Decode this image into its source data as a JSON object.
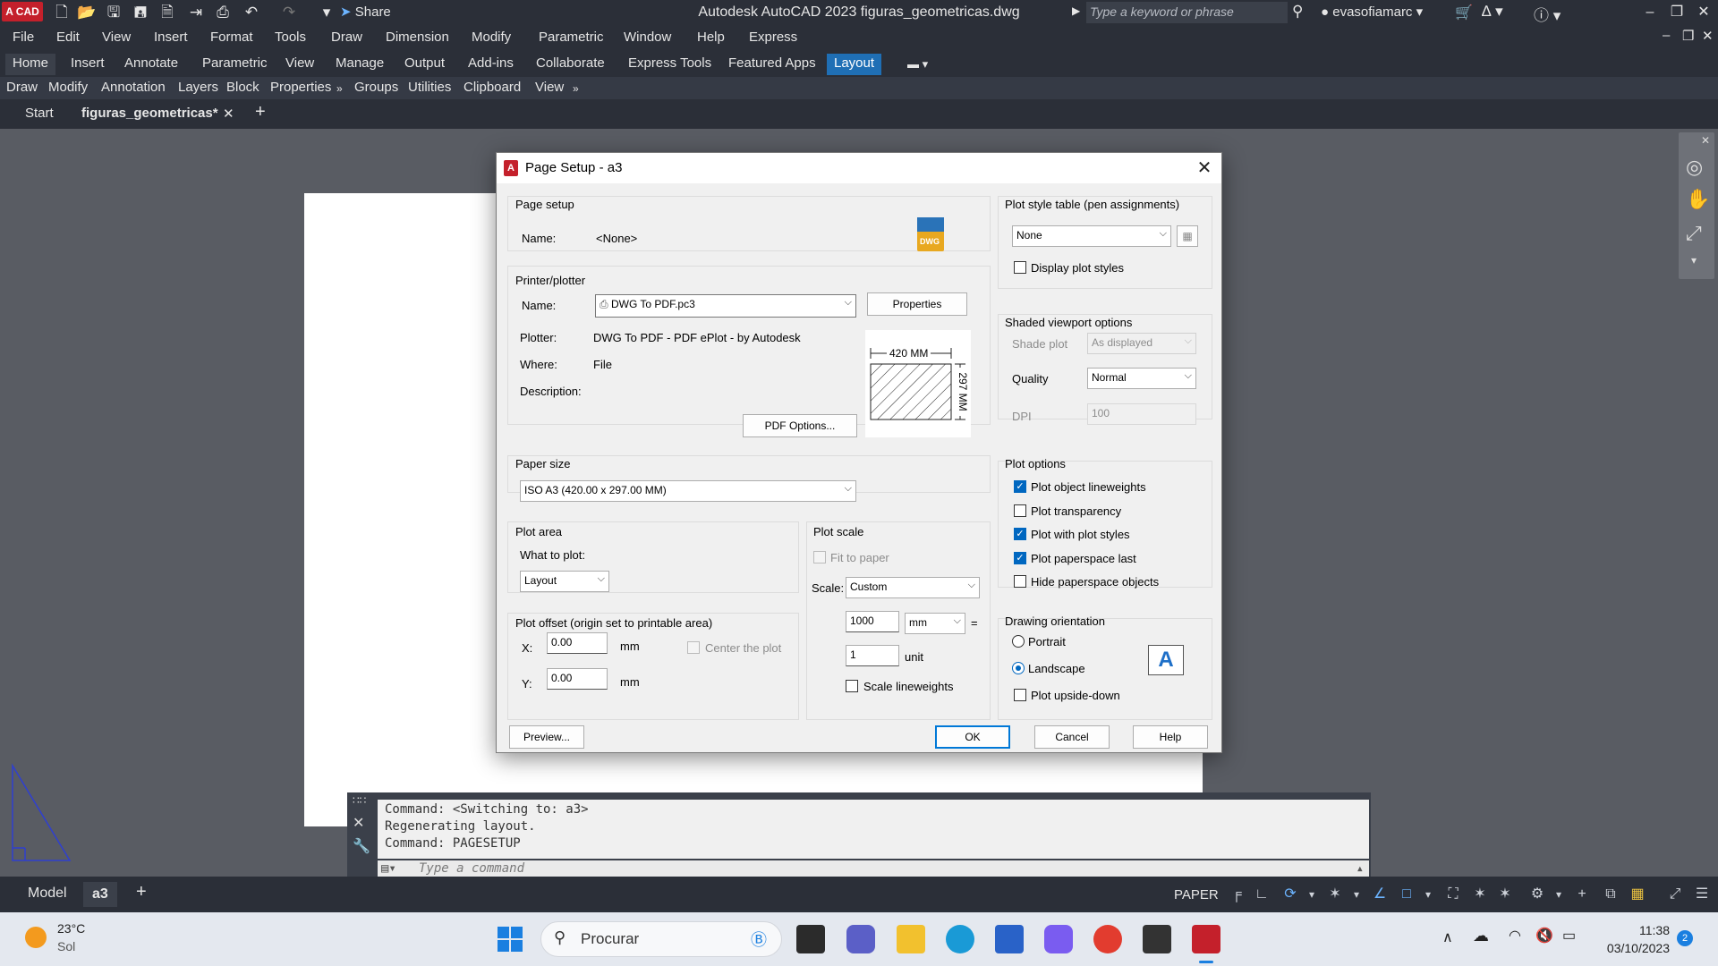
{
  "titlebar": {
    "app_logo": "A CAD",
    "share": "Share",
    "title": "Autodesk AutoCAD 2023    figuras_geometricas.dwg",
    "keyword_placeholder": "Type a keyword or phrase",
    "user": "evasofiamarc"
  },
  "menubar": [
    "File",
    "Edit",
    "View",
    "Insert",
    "Format",
    "Tools",
    "Draw",
    "Dimension",
    "Modify",
    "Parametric",
    "Window",
    "Help",
    "Express"
  ],
  "ribbon_tabs": [
    "Home",
    "Insert",
    "Annotate",
    "Parametric",
    "View",
    "Manage",
    "Output",
    "Add-ins",
    "Collaborate",
    "Express Tools",
    "Featured Apps",
    "Layout"
  ],
  "panels": [
    "Draw",
    "Modify",
    "Annotation",
    "Layers",
    "Block",
    "Properties",
    "Groups",
    "Utilities",
    "Clipboard",
    "View"
  ],
  "file_tabs": {
    "start": "Start",
    "file": "figuras_geometricas*"
  },
  "command": {
    "lines": [
      "Command:   <Switching to: a3>",
      "Regenerating layout.",
      "Command: PAGESETUP"
    ],
    "placeholder": "Type a command"
  },
  "layout_tabs": {
    "model": "Model",
    "a3": "a3",
    "paper": "PAPER"
  },
  "taskbar": {
    "temp": "23°C",
    "weather": "Sol",
    "search": "Procurar",
    "time": "11:38",
    "date": "03/10/2023",
    "notif": "2"
  },
  "dialog": {
    "title": "Page Setup - a3",
    "page_setup": {
      "title": "Page setup",
      "name_label": "Name:",
      "name_value": "<None>",
      "dwg_icon": "DWG"
    },
    "printer": {
      "title": "Printer/plotter",
      "name_label": "Name:",
      "name_value": "DWG To PDF.pc3",
      "properties": "Properties",
      "plotter_label": "Plotter:",
      "plotter_value": "DWG To PDF - PDF ePlot - by Autodesk",
      "where_label": "Where:",
      "where_value": "File",
      "desc_label": "Description:",
      "pdf_options": "PDF Options...",
      "preview_w": "420  MM",
      "preview_h": "297  MM"
    },
    "paper_size": {
      "title": "Paper size",
      "value": "ISO A3 (420.00 x 297.00 MM)"
    },
    "plot_area": {
      "title": "Plot area",
      "what_label": "What to plot:",
      "what_value": "Layout"
    },
    "plot_offset": {
      "title": "Plot offset (origin set to printable area)",
      "x_label": "X:",
      "x_value": "0.00",
      "y_label": "Y:",
      "y_value": "0.00",
      "unit": "mm",
      "center": "Center the plot"
    },
    "plot_scale": {
      "title": "Plot scale",
      "fit": "Fit to paper",
      "scale_label": "Scale:",
      "scale_value": "Custom",
      "num": "1000",
      "num_unit": "mm",
      "equals": "=",
      "den": "1",
      "den_unit": "unit",
      "lineweights": "Scale lineweights"
    },
    "plot_style": {
      "title": "Plot style table (pen assignments)",
      "value": "None",
      "display": "Display plot styles"
    },
    "shaded": {
      "title": "Shaded viewport options",
      "shade_label": "Shade plot",
      "shade_value": "As displayed",
      "quality_label": "Quality",
      "quality_value": "Normal",
      "dpi_label": "DPI",
      "dpi_value": "100"
    },
    "plot_options": {
      "title": "Plot options",
      "items": [
        {
          "label": "Plot object lineweights",
          "checked": true
        },
        {
          "label": "Plot transparency",
          "checked": false
        },
        {
          "label": "Plot with plot styles",
          "checked": true
        },
        {
          "label": "Plot paperspace last",
          "checked": true
        },
        {
          "label": "Hide paperspace objects",
          "checked": false
        }
      ]
    },
    "orientation": {
      "title": "Drawing orientation",
      "portrait": "Portrait",
      "landscape": "Landscape",
      "upside": "Plot upside-down",
      "icon_letter": "A"
    },
    "buttons": {
      "preview": "Preview...",
      "ok": "OK",
      "cancel": "Cancel",
      "help": "Help"
    }
  }
}
